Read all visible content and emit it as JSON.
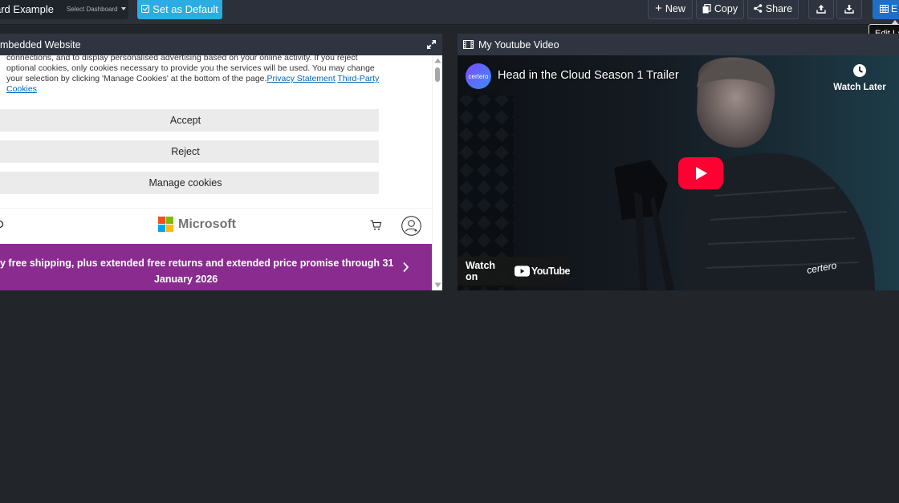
{
  "topbar": {
    "dashboard_name": "ard Example",
    "select_label": "Select Dashboard",
    "set_default": "Set as Default",
    "new": "New",
    "copy": "Copy",
    "share": "Share",
    "edit": "E",
    "tooltip": "Edit La"
  },
  "panel1": {
    "title": "mbedded Website",
    "cookie_text": "connections, and to display personalised advertising based on your online activity. If you reject optional cookies, only cookies necessary to provide you the services will be used. You may change your selection by clicking 'Manage Cookies' at the bottom of the page.",
    "privacy_link": "Privacy Statement",
    "third_party_link": "Third-Party Cookies",
    "accept": "Accept",
    "reject": "Reject",
    "manage": "Manage cookies",
    "brand": "Microsoft",
    "promo_line1": "y free shipping, plus extended free returns and extended price promise through 31",
    "promo_line2": "January 2026"
  },
  "panel2": {
    "title": "My Youtube Video",
    "video_title": "Head in the Cloud Season 1 Trailer",
    "channel_badge": "certero",
    "watch_later": "Watch Later",
    "watch_on": "Watch on",
    "youtube": "YouTube",
    "jacket_brand": "certero"
  },
  "colors": {
    "accent": "#2bace2",
    "edit_blue": "#1f6fc6",
    "promo_purple": "#8a2b8f",
    "youtube_red": "#ff0033"
  }
}
